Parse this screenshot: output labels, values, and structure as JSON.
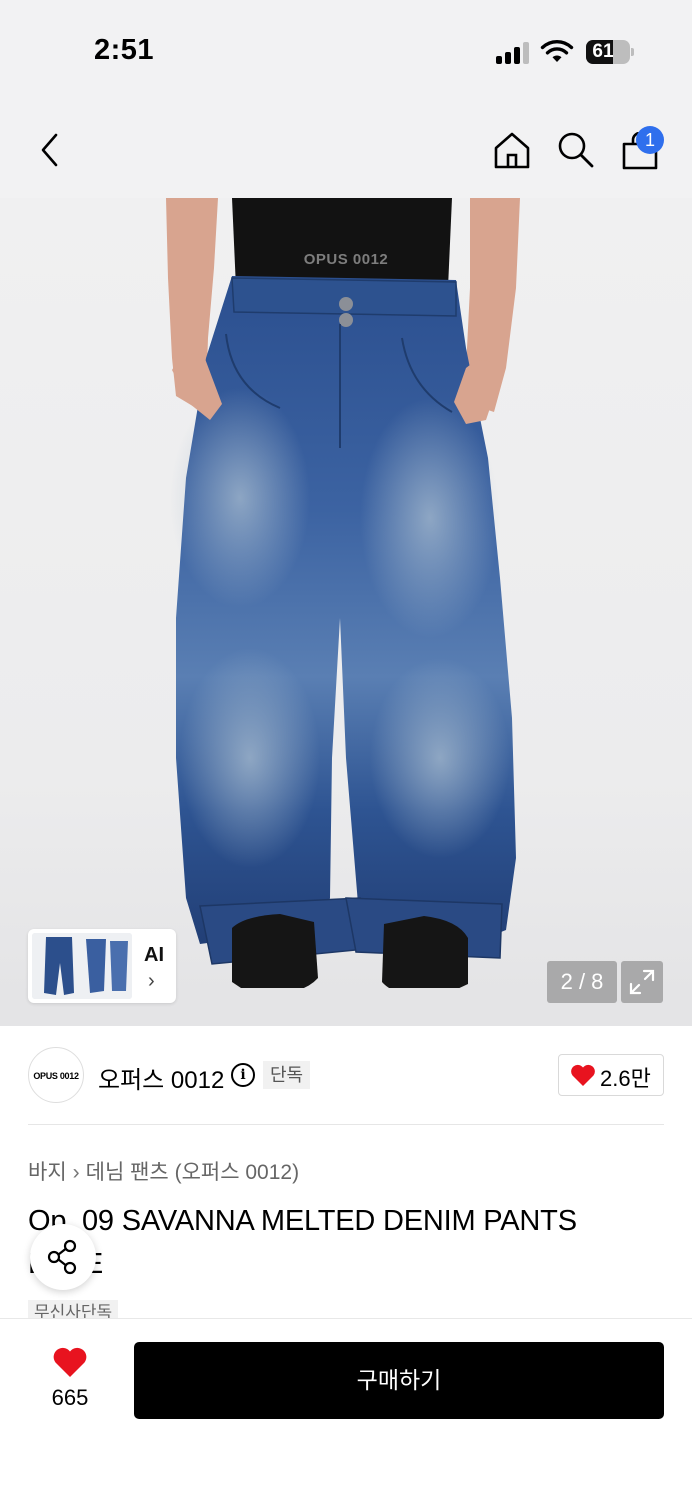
{
  "status_bar": {
    "time": "2:51",
    "battery": "61",
    "battery_level": 0.61
  },
  "nav": {
    "icons": [
      "back-icon",
      "home-icon",
      "search-icon",
      "cart-icon"
    ],
    "cart_badge": "1"
  },
  "gallery": {
    "print_text": "OPUS 0012",
    "thumb_ai_label": "AI",
    "thumb_chevron": "›",
    "page_indicator": "2 / 8",
    "expand_icon": "expand-icon"
  },
  "brand": {
    "logo_text": "OPUS 0012",
    "name": "오퍼스 0012",
    "info_icon": "i",
    "badge": "단독",
    "like_count": "2.6만"
  },
  "product": {
    "breadcrumb": [
      "바지",
      "데님 팬츠 (오퍼스 0012)"
    ],
    "breadcrumb_sep": "›",
    "title_line1": "Op. 09 SAVANNA MELTED DENIM PANTS",
    "title_line2": "BLUE",
    "tag": "무신사단독"
  },
  "bottom_bar": {
    "like_count": "665",
    "buy_label": "구매하기"
  },
  "colors": {
    "accent_blue": "#2f6fed",
    "heart_red": "#e8131f",
    "buy_bg": "#000000"
  }
}
